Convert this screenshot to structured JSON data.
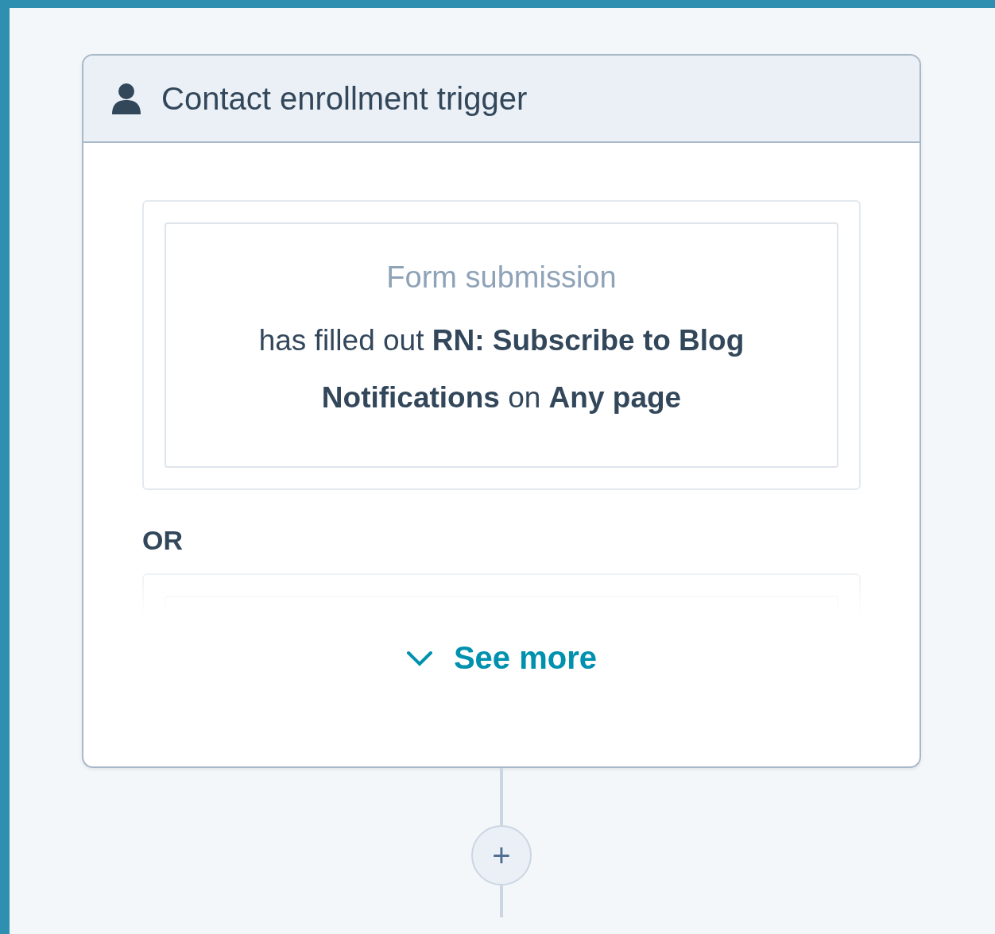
{
  "card": {
    "title": "Contact enrollment trigger",
    "items": [
      {
        "kind": "filter",
        "title": "Form submission",
        "description": "has filled out **RN: Subscribe to Blog Notifications** on **Any page**"
      },
      {
        "kind": "separator",
        "label": "OR"
      },
      {
        "kind": "clipped"
      }
    ],
    "see_more": {
      "label": "See more",
      "expanded": false
    }
  },
  "add_button": {
    "label": "+"
  }
}
